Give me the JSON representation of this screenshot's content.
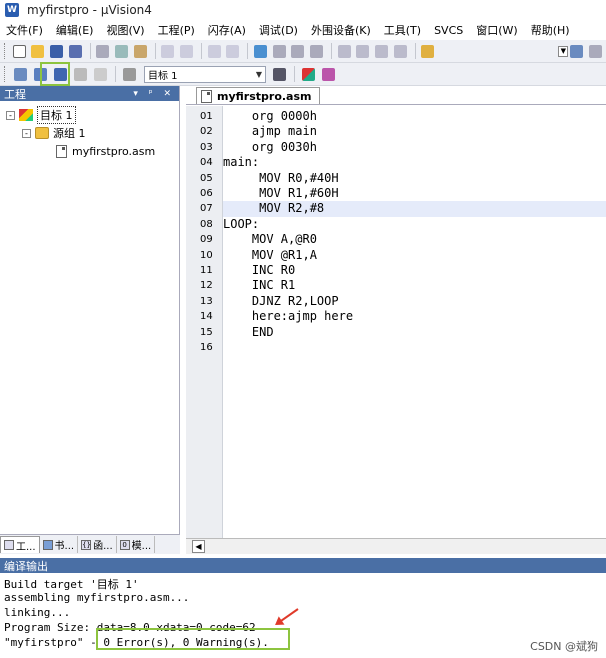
{
  "window": {
    "title": "myfirstpro  - µVision4",
    "app_icon": "W"
  },
  "menu": [
    "文件(F)",
    "编辑(E)",
    "视图(V)",
    "工程(P)",
    "闪存(A)",
    "调试(D)",
    "外围设备(K)",
    "工具(T)",
    "SVCS",
    "窗口(W)",
    "帮助(H)"
  ],
  "toolbar2": {
    "target_select": "目标 1"
  },
  "project": {
    "header": "工程",
    "header_controls": "▾ ᵖ ✕",
    "tree": [
      {
        "label": "目标 1",
        "level": 0,
        "expander": "-",
        "icon": "target-icon"
      },
      {
        "label": "源组 1",
        "level": 1,
        "expander": "-",
        "icon": "folder-icon"
      },
      {
        "label": "myfirstpro.asm",
        "level": 2,
        "expander": "",
        "icon": "asm-file-icon"
      }
    ],
    "tabs": [
      {
        "label": "工...",
        "icon": "project-tab-icon"
      },
      {
        "label": "书...",
        "icon": "books-tab-icon"
      },
      {
        "label": "函...",
        "icon": "functions-tab-icon"
      },
      {
        "label": "模...",
        "icon": "templates-tab-icon"
      }
    ]
  },
  "editor": {
    "tab_label": "myfirstpro.asm",
    "current_line": 7,
    "lines": [
      {
        "no": "01",
        "text": "    org 0000h"
      },
      {
        "no": "02",
        "text": "    ajmp main"
      },
      {
        "no": "03",
        "text": "    org 0030h"
      },
      {
        "no": "04",
        "text": "main:"
      },
      {
        "no": "05",
        "text": "     MOV R0,#40H"
      },
      {
        "no": "06",
        "text": "     MOV R1,#60H"
      },
      {
        "no": "07",
        "text": "     MOV R2,#8"
      },
      {
        "no": "08",
        "text": "LOOP:"
      },
      {
        "no": "09",
        "text": "    MOV A,@R0"
      },
      {
        "no": "10",
        "text": "    MOV @R1,A"
      },
      {
        "no": "11",
        "text": "    INC R0"
      },
      {
        "no": "12",
        "text": "    INC R1"
      },
      {
        "no": "13",
        "text": "    DJNZ R2,LOOP"
      },
      {
        "no": "14",
        "text": "    here:ajmp here"
      },
      {
        "no": "15",
        "text": "    END"
      },
      {
        "no": "16",
        "text": ""
      }
    ]
  },
  "output": {
    "header": "编译输出",
    "lines": [
      "Build target '目标 1'",
      "assembling myfirstpro.asm...",
      "linking...",
      "Program Size: data=8.0 xdata=0 code=62",
      "\"myfirstpro\" - 0 Error(s), 0 Warning(s)."
    ]
  },
  "watermark": "CSDN @斌狗",
  "colors": {
    "highlight_box": "#8dc43f",
    "arrow": "#e03a2a",
    "panel_header": "#4a6fa5",
    "current_line": "#e5ebfa"
  }
}
